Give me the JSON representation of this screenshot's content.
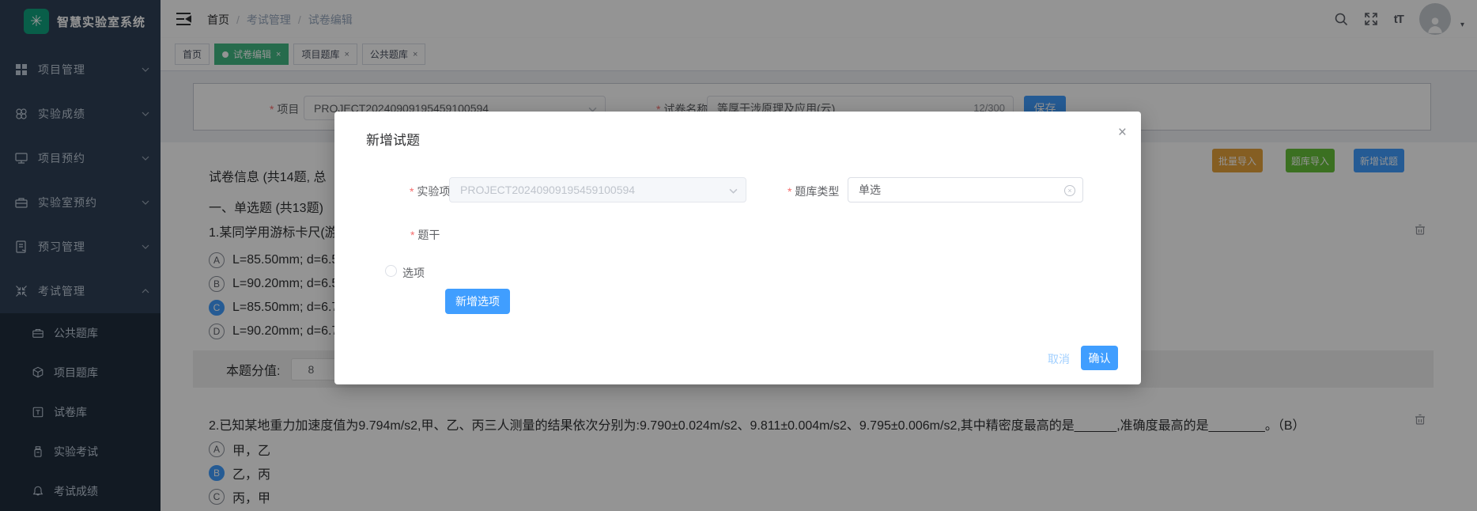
{
  "app": {
    "title": "智慧实验室系统"
  },
  "sidebar": {
    "items": [
      {
        "icon": "grid-icon",
        "label": "项目管理"
      },
      {
        "icon": "clover-icon",
        "label": "实验成绩"
      },
      {
        "icon": "monitor-icon",
        "label": "项目预约"
      },
      {
        "icon": "briefcase-icon",
        "label": "实验室预约"
      },
      {
        "icon": "notebook-icon",
        "label": "预习管理"
      },
      {
        "icon": "compress-icon",
        "label": "考试管理",
        "expanded": true
      }
    ],
    "subitems": [
      {
        "icon": "briefcase-icon",
        "label": "公共题库"
      },
      {
        "icon": "cube-icon",
        "label": "项目题库"
      },
      {
        "icon": "tsquare-icon",
        "label": "试卷库"
      },
      {
        "icon": "jar-icon",
        "label": "实验考试"
      },
      {
        "icon": "bell-icon",
        "label": "考试成绩"
      }
    ]
  },
  "breadcrumb": {
    "items": [
      "首页",
      "考试管理",
      "试卷编辑"
    ],
    "separator": "/"
  },
  "tabs": [
    {
      "label": "首页",
      "closable": false,
      "active": false
    },
    {
      "label": "试卷编辑",
      "closable": true,
      "active": true
    },
    {
      "label": "项目题库",
      "closable": true,
      "active": false
    },
    {
      "label": "公共题库",
      "closable": true,
      "active": false
    }
  ],
  "header_icons": {
    "font_size_glyph": "tT",
    "close_glyph": "×",
    "caret_glyph": "▾"
  },
  "form": {
    "project_label": "项目",
    "project_value": "PROJECT20240909195459100594",
    "paper_label": "试卷名称",
    "paper_value": "等厚干涉原理及应用(云)",
    "counter": "12/300",
    "save": "保存"
  },
  "toolbar": {
    "batch_import": "批量导入",
    "bank_import": "题库导入",
    "add_question": "新增试题"
  },
  "paper": {
    "info": "试卷信息 (共14题, 总",
    "section_title": "一、单选题 (共13题)",
    "q1": {
      "text": "1.某同学用游标卡尺(游",
      "options": [
        {
          "key": "A",
          "text": "L=85.50mm; d=6.5",
          "selected": false
        },
        {
          "key": "B",
          "text": "L=90.20mm; d=6.5",
          "selected": false
        },
        {
          "key": "C",
          "text": "L=85.50mm; d=6.7",
          "selected": true
        },
        {
          "key": "D",
          "text": "L=90.20mm; d=6.7",
          "selected": false
        }
      ],
      "score_label": "本题分值:",
      "score": "8"
    },
    "q2": {
      "text": "2.已知某地重力加速度值为9.794m/s2,甲、乙、丙三人测量的结果依次分别为:9.790±0.024m/s2、9.811±0.004m/s2、9.795±0.006m/s2,其中精密度最高的是______,准确度最高的是________。（B）",
      "options": [
        {
          "key": "A",
          "text": "甲，乙",
          "selected": false
        },
        {
          "key": "B",
          "text": "乙，丙",
          "selected": true
        },
        {
          "key": "C",
          "text": "丙，甲",
          "selected": false
        }
      ]
    }
  },
  "modal": {
    "title": "新增试题",
    "project_label": "实验项目",
    "project_value": "PROJECT20240909195459100594",
    "type_label": "题库类型",
    "type_value": "单选",
    "stem_label": "题干",
    "option_label": "选项",
    "add_option": "新增选项",
    "cancel": "取消",
    "confirm": "确认"
  },
  "colors": {
    "primary": "#409EFF",
    "tab_active_green": "#42B983",
    "warning_orange": "#E6A23C",
    "success_green": "#67C23A",
    "sidebar_bg": "#304156",
    "submenu_bg": "#1F2D3D",
    "logo_green": "#10A37F"
  }
}
